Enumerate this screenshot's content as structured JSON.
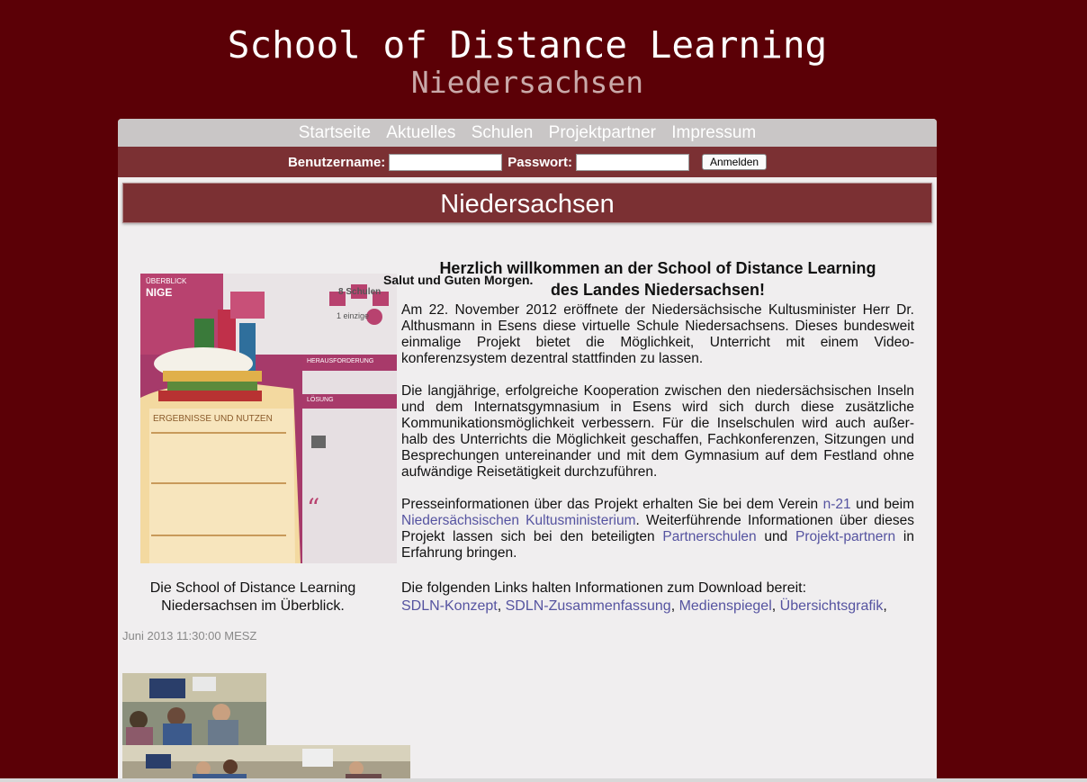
{
  "site": {
    "title": "School of Distance Learning",
    "subtitle": "Niedersachsen"
  },
  "nav": {
    "items": [
      "Startseite",
      "Aktuelles",
      "Schulen",
      "Projektpartner",
      "Impressum"
    ]
  },
  "login": {
    "username_label": "Benutzername:",
    "password_label": "Passwort:",
    "username_value": "",
    "password_value": "",
    "submit_label": "Anmelden"
  },
  "page": {
    "heading": "Niedersachsen",
    "greeting": "Salut und Guten Morgen.",
    "welcome_line1": "Herzlich willkommen an der School of Distance Learning",
    "welcome_line2": "des Landes Niedersachsen!",
    "p1": "Am 22. November 2012 eröffnete der Niedersächsische Kultusminister Herr Dr. Althusmann in Esens diese virtuelle Schule Niedersachsens. Dieses bundesweit einmalige Projekt bietet die Möglichkeit, Unterricht mit einem Video-konferenzsystem dezentral stattfinden zu lassen.",
    "p2": "Die langjährige, erfolgreiche Kooperation zwischen den niedersächsischen Inseln und dem Internatsgymnasium in Esens wird sich durch diese zusätzliche Kommunikationsmöglichkeit verbessern. Für die Inselschulen wird auch außer-halb des Unterrichts die Möglichkeit geschaffen, Fachkonferenzen, Sitzungen und Besprechungen untereinander und mit dem Gymnasium auf dem Festland ohne aufwändige Reisetätigkeit durchzuführen.",
    "p3": {
      "t1": "Presseinformationen über das Projekt erhalten Sie bei dem Verein ",
      "link1": "n-21",
      "t2": " und beim ",
      "link2": "Niedersächsischen Kultusministerium",
      "t3": ". Weiterführende Informationen über dieses Projekt lassen sich bei den beteiligten ",
      "link3": "Partnerschulen",
      "t4": " und ",
      "link4": "Projekt-partnern",
      "t5": " in Erfahrung bringen."
    },
    "downloads_intro": "Die folgenden Links halten Informationen zum Download bereit:",
    "downloads": [
      "SDLN-Konzept",
      "SDLN-Zusammenfassung",
      "Medienspiegel",
      "Übersichtsgrafik"
    ],
    "info_caption_line1": "Die School of Distance Learning",
    "info_caption_line2": "Niedersachsen im Überblick.",
    "timestamp": "Juni 2013 11:30:00 MESZ"
  },
  "infographic": {
    "overview_label": "ÜBERBLICK",
    "nige_label": "NIGE",
    "schools_label": "8 Schulen",
    "unique_label": "1 einzige",
    "challenge_label": "HERAUSFORDERUNG",
    "solution_label": "LÖSUNG",
    "results_label": "ERGEBNISSE UND NUTZEN"
  }
}
